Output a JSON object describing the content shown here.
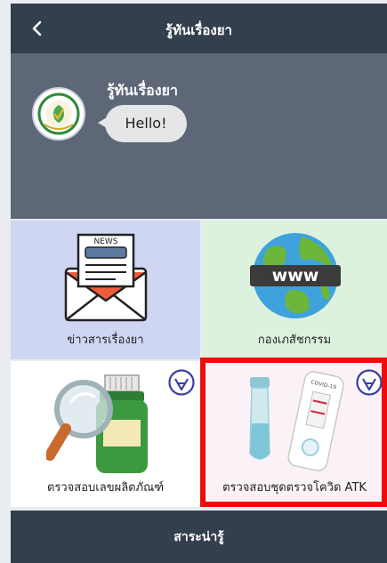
{
  "app": {
    "title": "รู้ทันเรื่องยา",
    "back_icon": "chevron-left-icon"
  },
  "chat": {
    "sender": "รู้ทันเรื่องยา",
    "message": "Hello!",
    "avatar": "agency-logo"
  },
  "menu": [
    {
      "label": "ข่าวสารเรื่องยา",
      "icon": "news-envelope-icon",
      "news_text": "NEWS",
      "bg": "#cfd6f2"
    },
    {
      "label": "กองเภสัชกรรม",
      "icon": "globe-www-icon",
      "www_text": "www",
      "bg": "#ddf2de"
    },
    {
      "label": "ตรวจสอบเลขผลิตภัณฑ์",
      "icon": "magnifier-bottle-icon",
      "badge": "verified-check-icon",
      "bg": "#ffffff"
    },
    {
      "label": "ตรวจสอบชุดตรวจโควิด ATK",
      "icon": "atk-test-kit-icon",
      "badge": "verified-check-icon",
      "bg": "#fbf2f8",
      "kit_text": "COVID-19"
    }
  ],
  "highlight_color": "#ee0d0d",
  "footer": {
    "label": "สาระน่ารู้"
  }
}
